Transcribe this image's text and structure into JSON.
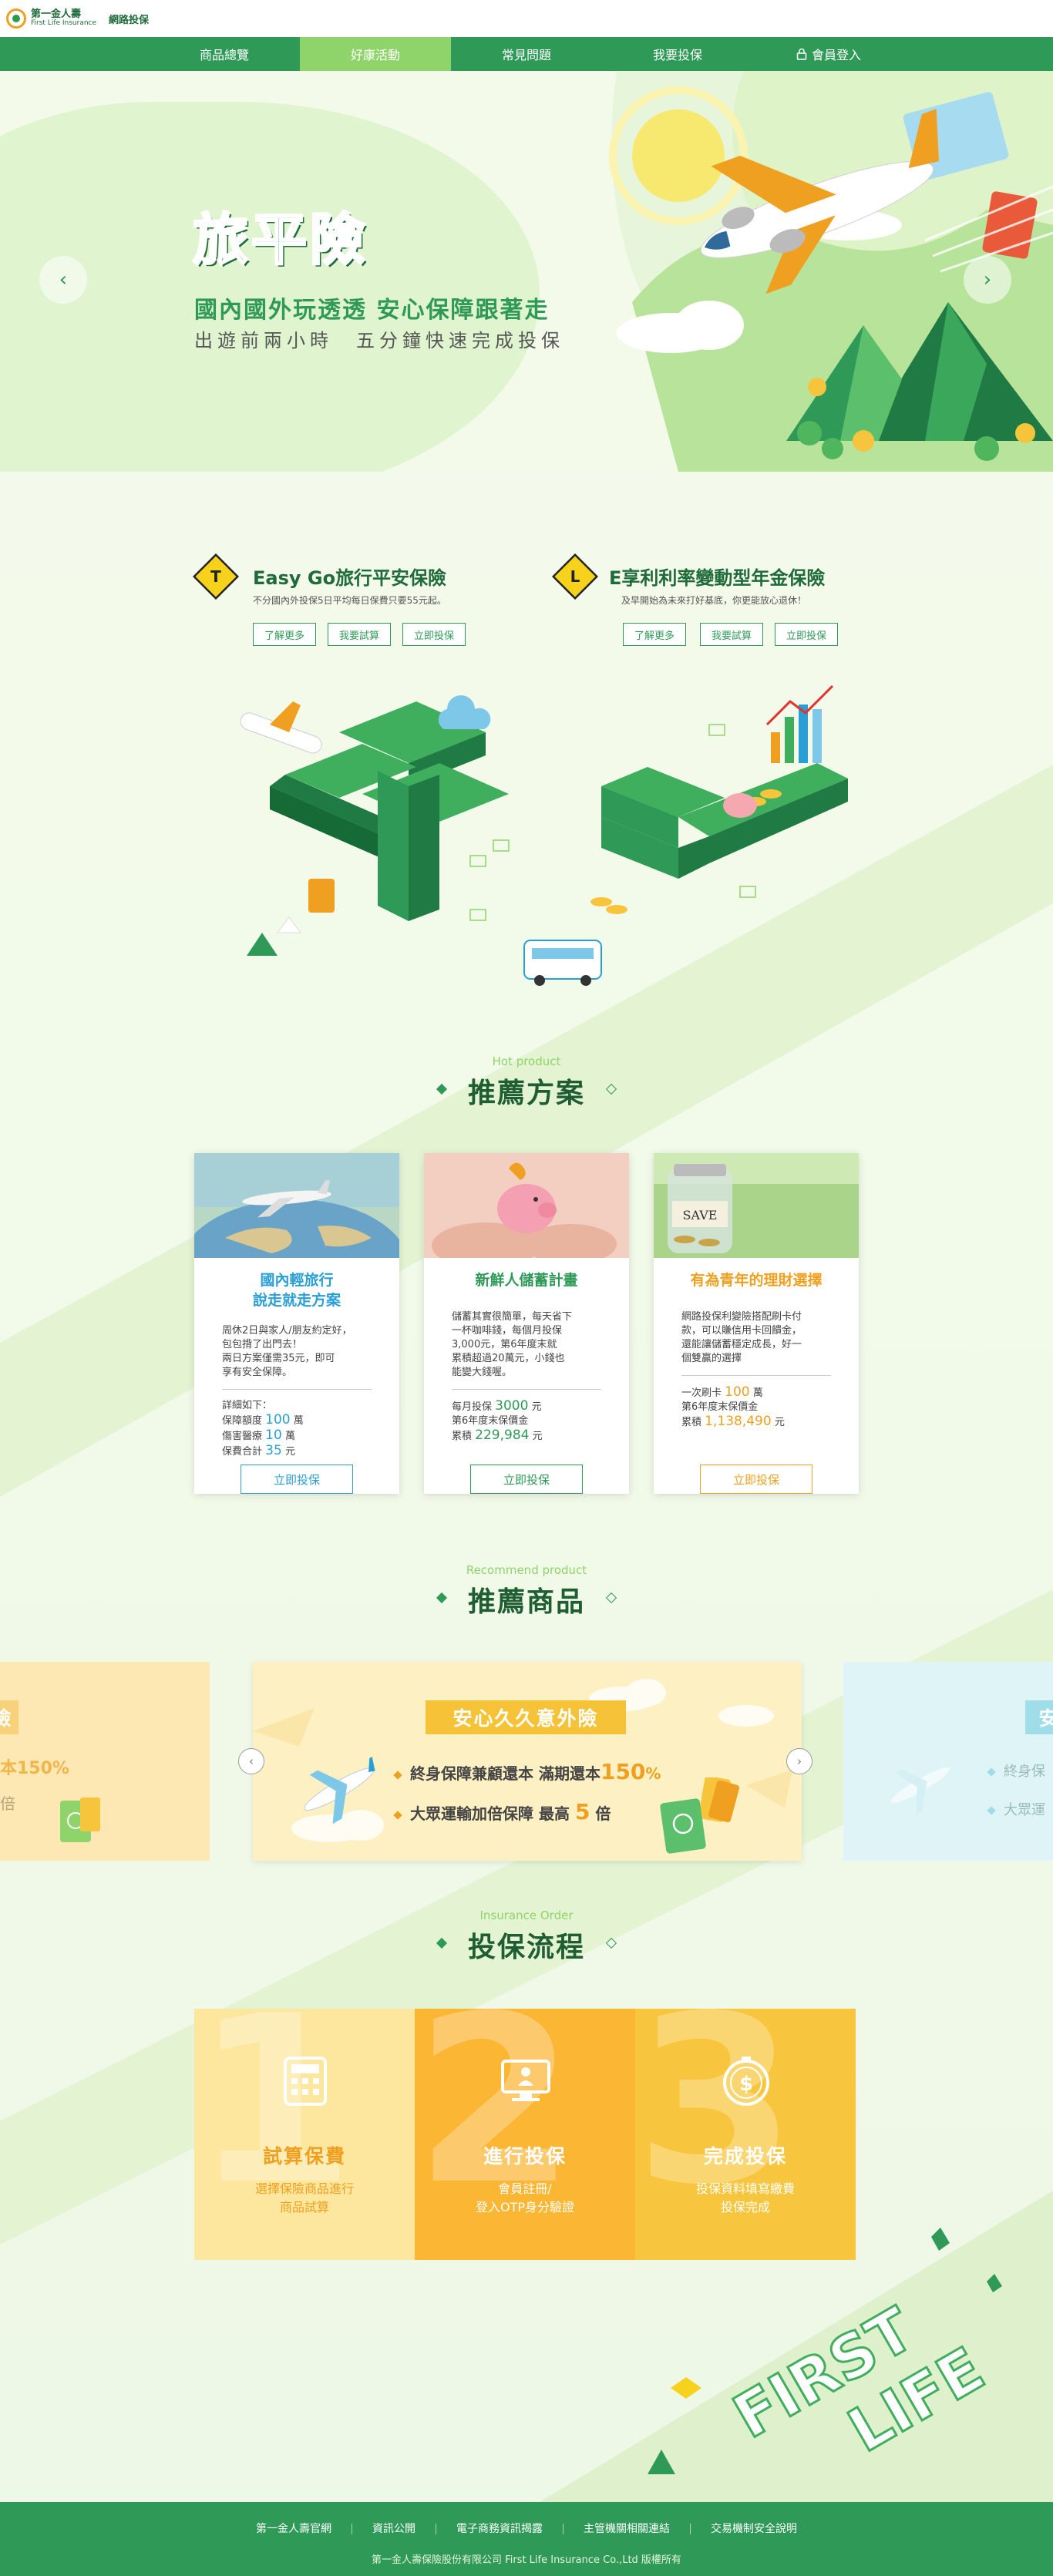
{
  "header": {
    "logo_zh": "第一金人壽",
    "logo_en": "First Life Insurance",
    "site_label": "網路投保"
  },
  "nav": {
    "items": [
      {
        "label": "商品總覽"
      },
      {
        "label": "好康活動"
      },
      {
        "label": "常見問題"
      },
      {
        "label": "我要投保"
      },
      {
        "label": "會員登入"
      }
    ],
    "active_index": 1
  },
  "hero": {
    "title": "旅平險",
    "subtitle": "國內國外玩透透 安心保障跟著走",
    "tagline": "出遊前兩小時　五分鐘快速完成投保"
  },
  "products": [
    {
      "badge": "T",
      "title": "Easy Go旅行平安保險",
      "desc": "不分國內外投保5日平均每日保費只要55元起。",
      "buttons": [
        "了解更多",
        "我要試算",
        "立即投保"
      ]
    },
    {
      "badge": "L",
      "title": "E享利利率變動型年金保險",
      "desc": "及早開始為未來打好基底，你更能放心退休！",
      "buttons": [
        "了解更多",
        "我要試算",
        "立即投保"
      ]
    }
  ],
  "hot": {
    "en": "Hot product",
    "zh": "推薦方案",
    "cards": [
      {
        "title_lines": [
          "國內輕旅行",
          "說走就走方案"
        ],
        "body": [
          "周休2日與家人/朋友約定好，",
          "包包揹了出門去！",
          "兩日方案僅需35元，即可",
          "享有安全保障。"
        ],
        "stats_intro": "詳細如下：",
        "stats": [
          {
            "label": "保障額度",
            "value": "100",
            "unit": "萬"
          },
          {
            "label": "傷害醫療",
            "value": "10",
            "unit": "萬"
          },
          {
            "label": "保費合計",
            "value": "35",
            "unit": "元"
          }
        ],
        "button": "立即投保",
        "color": "#2a9fd6"
      },
      {
        "title_lines": [
          "新鮮人儲蓄計畫"
        ],
        "body": [
          "儲蓄其實很簡單，每天省下",
          "一杯咖啡錢，每個月投保",
          "3,000元，第6年度末就",
          "累積超過20萬元，小錢也",
          "能變大錢喔。"
        ],
        "stats_intro": "",
        "stats": [
          {
            "label": "每月投保",
            "value": "3000",
            "unit": "元"
          },
          {
            "label": "第6年度末保價金",
            "value": "",
            "unit": ""
          },
          {
            "label": "累積",
            "value": "229,984",
            "unit": "元"
          }
        ],
        "button": "立即投保",
        "color": "#2f9a57"
      },
      {
        "title_lines": [
          "有為青年的理財選擇"
        ],
        "body": [
          "網路投保利變險搭配刷卡付",
          "款，可以賺信用卡回饋金，",
          "還能讓儲蓄穩定成長，好一",
          "個雙贏的選擇"
        ],
        "stats_intro": "",
        "stats": [
          {
            "label": "一次刷卡",
            "value": "100",
            "unit": "萬"
          },
          {
            "label": "第6年度末保價金",
            "value": "",
            "unit": ""
          },
          {
            "label": "累積",
            "value": "1,138,490",
            "unit": "元"
          }
        ],
        "button": "立即投保",
        "color": "#f0a020"
      }
    ]
  },
  "recommend": {
    "en": "Recommend product",
    "zh": "推薦商品",
    "slide": {
      "ribbon": "安心久久意外險",
      "line1_prefix": "終身保障兼顧還本",
      "line1_mid": "滿期還本",
      "line1_value": "150",
      "line1_unit": "%",
      "line2_prefix": "大眾運輸加倍保障",
      "line2_mid": "最高",
      "line2_value": "5",
      "line2_unit": "倍"
    },
    "left_peek": {
      "ribbon_tail": "險",
      "line1_tail": "本150%",
      "line2_tail": "倍"
    },
    "right_peek": {
      "ribbon_head": "安",
      "line1_head": "終身保",
      "line2_head": "大眾運"
    }
  },
  "order": {
    "en": "Insurance Order",
    "zh": "投保流程",
    "steps": [
      {
        "num": "1",
        "title": "試算保費",
        "desc": [
          "選擇保險商品進行",
          "商品試算"
        ],
        "color": "#fde59a"
      },
      {
        "num": "2",
        "title": "進行投保",
        "desc": [
          "會員註冊/",
          "登入OTP身分驗證"
        ],
        "color": "#fbb634"
      },
      {
        "num": "3",
        "title": "完成投保",
        "desc": [
          "投保資料填寫繳費",
          "投保完成"
        ],
        "color": "#f7c53c"
      }
    ]
  },
  "deco_text": [
    "FIRST",
    "LIFE"
  ],
  "footer": {
    "links": [
      "第一金人壽官網",
      "資訊公開",
      "電子商務資訊揭露",
      "主管機關相關連結",
      "交易機制安全說明"
    ],
    "copyright": "第一金人壽保險股份有限公司 First Life Insurance Co.,Ltd 版權所有"
  }
}
